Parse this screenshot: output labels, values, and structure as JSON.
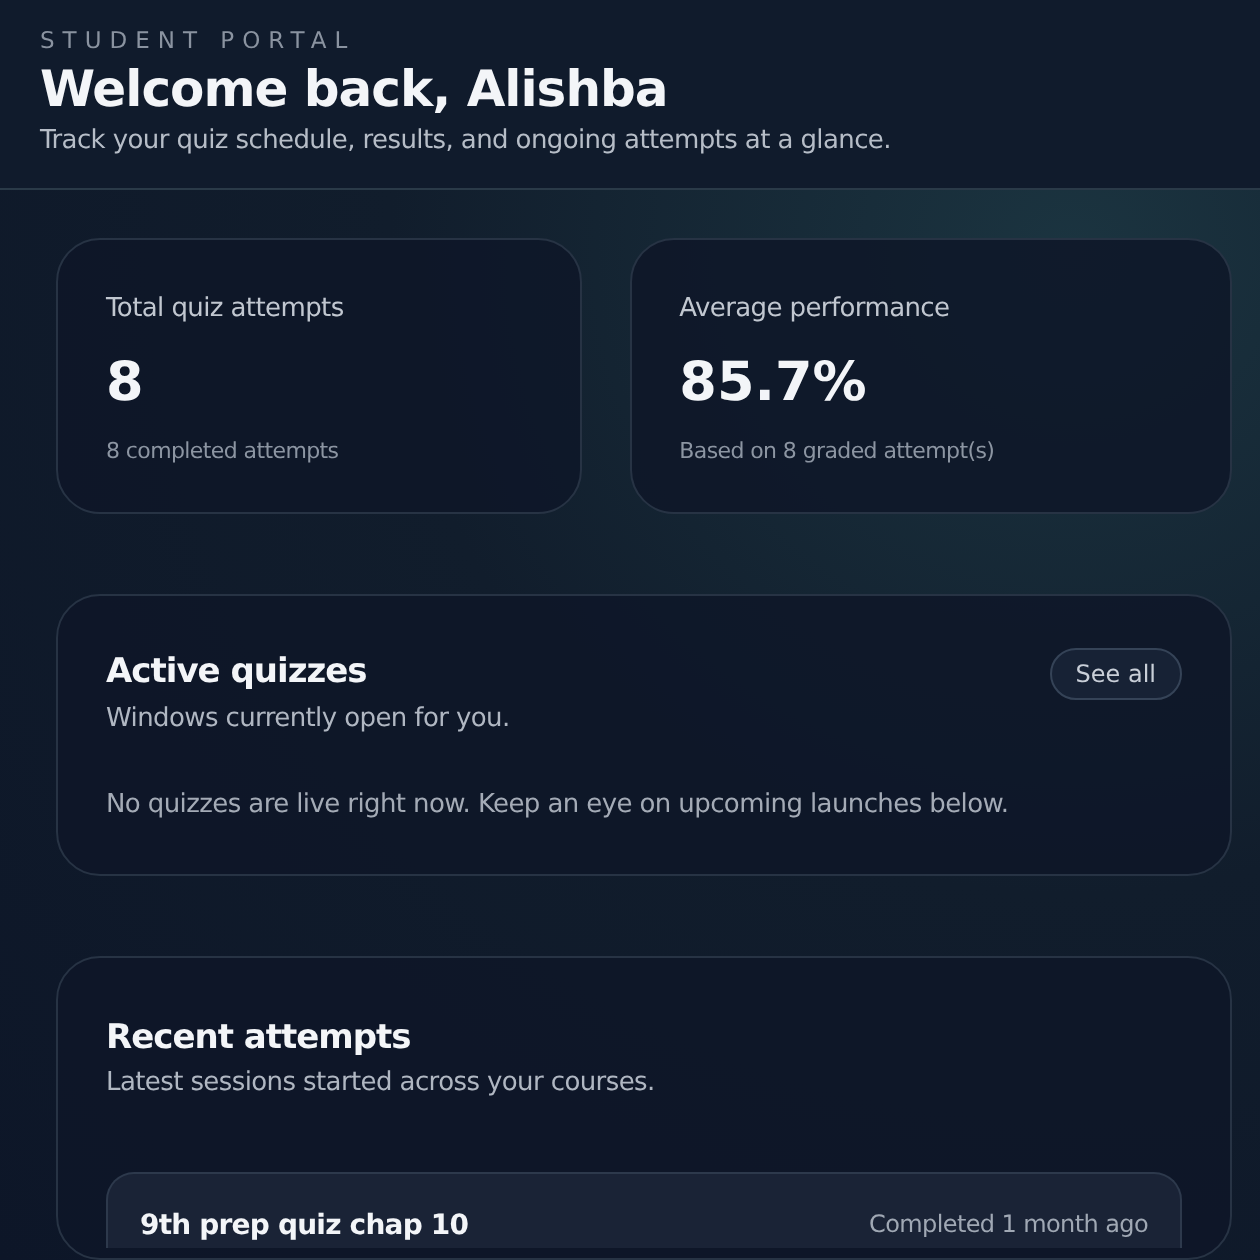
{
  "header": {
    "eyebrow": "STUDENT PORTAL",
    "title": "Welcome back, Alishba",
    "subtitle": "Track your quiz schedule, results, and ongoing attempts at a glance."
  },
  "stats": [
    {
      "label": "Total quiz attempts",
      "value": "8",
      "note": "8 completed attempts"
    },
    {
      "label": "Average performance",
      "value": "85.7%",
      "note": "Based on 8 graded attempt(s)"
    }
  ],
  "active_quizzes": {
    "title": "Active quizzes",
    "subtitle": "Windows currently open for you.",
    "button": "See all",
    "empty_message": "No quizzes are live right now. Keep an eye on upcoming launches below."
  },
  "recent_attempts": {
    "title": "Recent attempts",
    "subtitle": "Latest sessions started across your courses.",
    "items": [
      {
        "title": "9th prep quiz chap 10",
        "status": "Completed 1 month ago"
      }
    ]
  }
}
